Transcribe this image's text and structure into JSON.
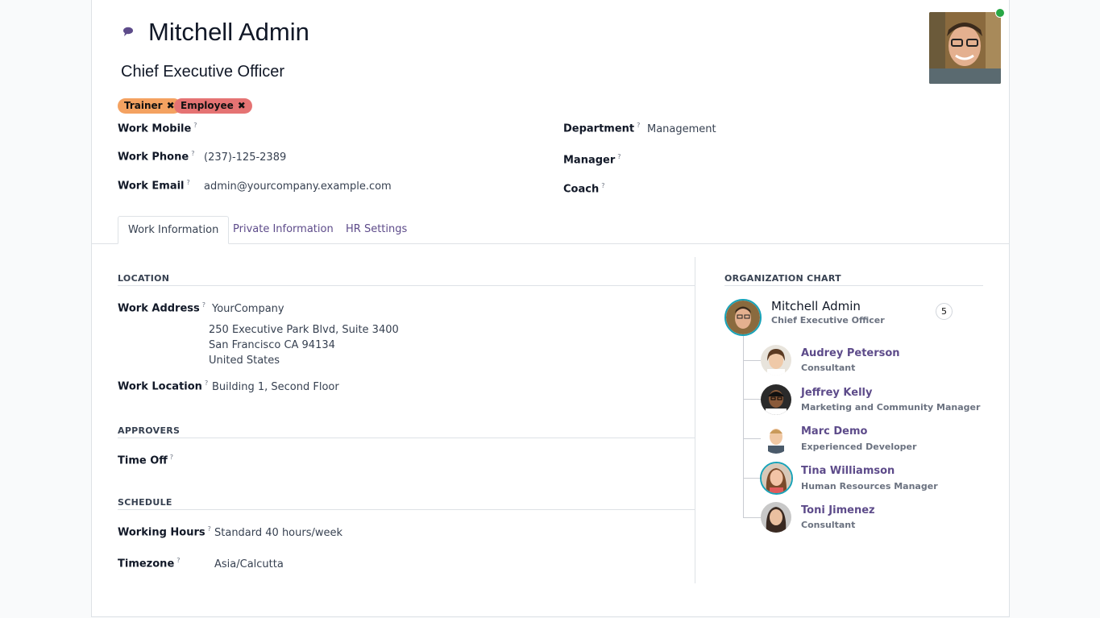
{
  "employee": {
    "name": "Mitchell Admin",
    "job_title": "Chief Executive Officer"
  },
  "tags": [
    "Trainer",
    "Employee"
  ],
  "contact": {
    "work_mobile_label": "Work Mobile",
    "work_phone_label": "Work Phone",
    "work_phone": "(237)-125-2389",
    "work_email_label": "Work Email",
    "work_email": "admin@yourcompany.example.com",
    "department_label": "Department",
    "department": "Management",
    "manager_label": "Manager",
    "coach_label": "Coach",
    "help_mark": "?"
  },
  "tabs": [
    "Work Information",
    "Private Information",
    "HR Settings"
  ],
  "location": {
    "title": "LOCATION",
    "work_address_label": "Work Address",
    "company": "YourCompany",
    "street": "250 Executive Park Blvd, Suite 3400",
    "city": "San Francisco CA 94134",
    "country": "United States",
    "work_location_label": "Work Location",
    "work_location": "Building 1, Second Floor"
  },
  "approvers": {
    "title": "APPROVERS",
    "time_off_label": "Time Off"
  },
  "schedule": {
    "title": "SCHEDULE",
    "working_hours_label": "Working Hours",
    "working_hours": "Standard 40 hours/week",
    "timezone_label": "Timezone",
    "timezone": "Asia/Calcutta"
  },
  "org_chart": {
    "title": "ORGANIZATION CHART",
    "self_name": "Mitchell Admin",
    "self_job": "Chief Executive Officer",
    "count": "5",
    "subordinates": [
      {
        "name": "Audrey Peterson",
        "job": "Consultant"
      },
      {
        "name": "Jeffrey Kelly",
        "job": "Marketing and Community Manager"
      },
      {
        "name": "Marc Demo",
        "job": "Experienced Developer"
      },
      {
        "name": "Tina Williamson",
        "job": "Human Resources Manager"
      },
      {
        "name": "Toni Jimenez",
        "job": "Consultant"
      }
    ]
  },
  "colors": {
    "accent": "#5d4b8a",
    "tag_trainer": "#f4a261",
    "tag_employee": "#e57373",
    "online": "#28a745"
  }
}
